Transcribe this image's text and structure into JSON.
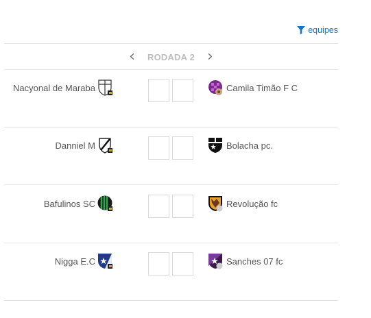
{
  "filter": {
    "label": "equipes",
    "icon": "filter-icon",
    "color": "#1a73c8"
  },
  "round": {
    "title": "RODADA 2",
    "prev_icon": "chevron-left-icon",
    "next_icon": "chevron-right-icon"
  },
  "matches": [
    {
      "home": "Nacyonal de Maraba",
      "away": "Camila Timão F C"
    },
    {
      "home": "Danniel M",
      "away": "Bolacha pc."
    },
    {
      "home": "Bafulinos SC",
      "away": "Revolução fc"
    },
    {
      "home": "Nigga E.C",
      "away": "Sanches 07 fc"
    }
  ]
}
